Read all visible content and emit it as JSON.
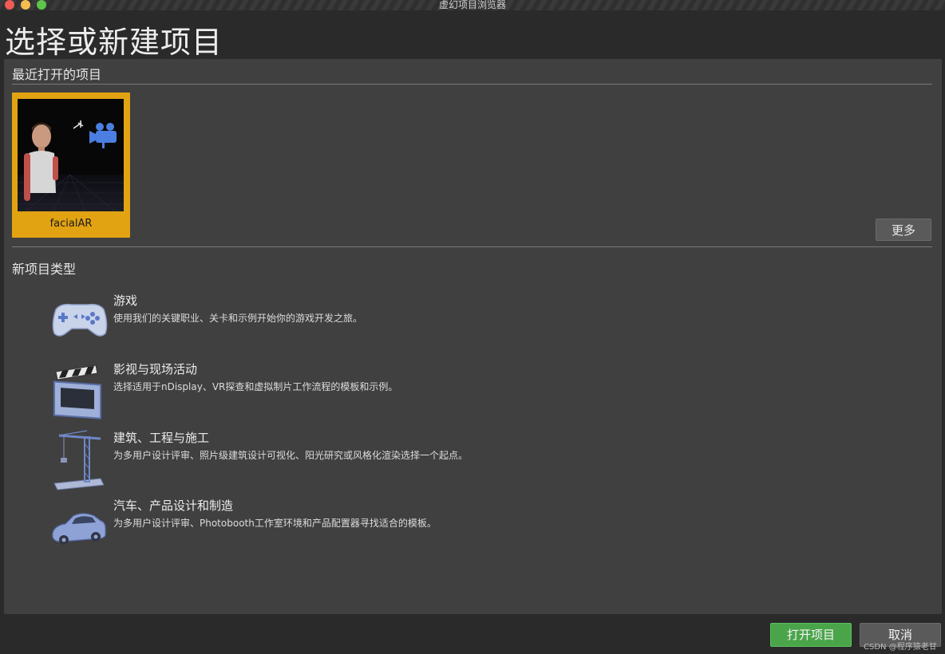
{
  "window": {
    "title": "虚幻项目浏览器"
  },
  "page": {
    "title": "选择或新建项目"
  },
  "recent": {
    "heading": "最近打开的项目",
    "projects": [
      {
        "name": "facialAR",
        "thumbnail_icon": "character-with-camera-thumbnail"
      }
    ],
    "more_label": "更多"
  },
  "new_types": {
    "heading": "新项目类型",
    "categories": [
      {
        "title": "游戏",
        "description": "使用我们的关键职业、关卡和示例开始你的游戏开发之旅。",
        "icon": "gamepad-icon"
      },
      {
        "title": "影视与现场活动",
        "description": "选择适用于nDisplay、VR探查和虚拟制片工作流程的模板和示例。",
        "icon": "clapperboard-icon"
      },
      {
        "title": "建筑、工程与施工",
        "description": "为多用户设计评审、照片级建筑设计可视化、阳光研究或风格化渲染选择一个起点。",
        "icon": "crane-icon"
      },
      {
        "title": "汽车、产品设计和制造",
        "description": "为多用户设计评审、Photobooth工作室环境和产品配置器寻找适合的模板。",
        "icon": "car-icon"
      }
    ]
  },
  "footer": {
    "open_label": "打开项目",
    "cancel_label": "取消"
  },
  "watermark": "CSDN @程序猿老甘",
  "colors": {
    "accent_selected": "#e2a312",
    "open_button": "#4aa54a",
    "panel": "#404040",
    "background": "#2a2a2a"
  }
}
